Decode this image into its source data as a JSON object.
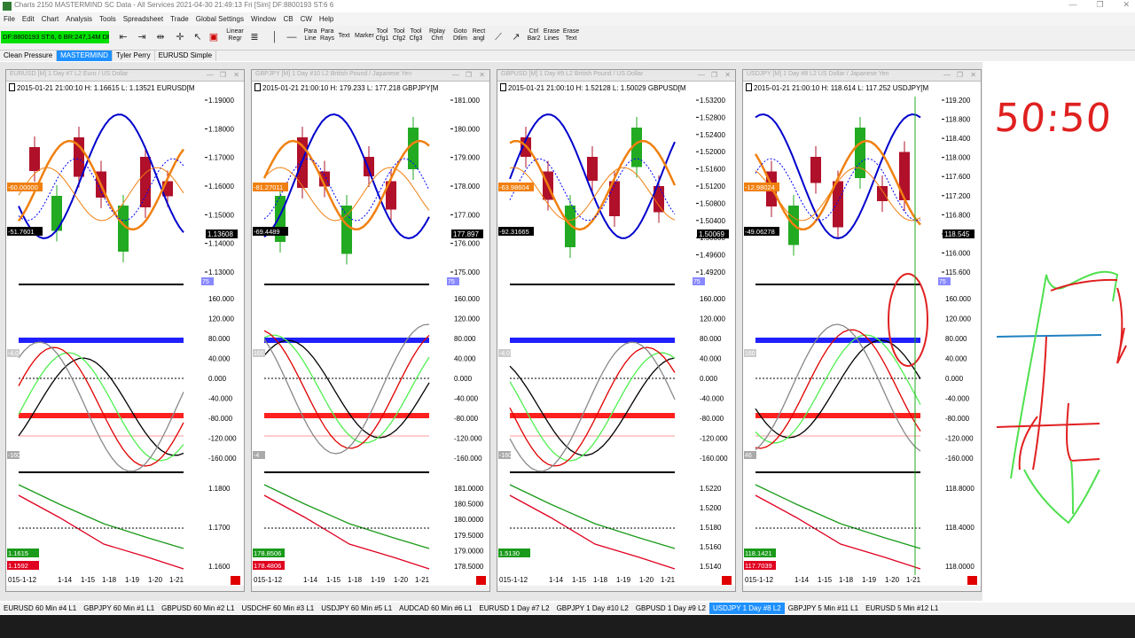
{
  "window": {
    "title": "Charts 2150 MASTERMIND  SC Data - All Services  2021-04-30  21:49:13 Fri [Sim]  DF:8800193  ST:6  6",
    "controls": [
      "—",
      "❐",
      "✕"
    ]
  },
  "menu": [
    "File",
    "Edit",
    "Chart",
    "Analysis",
    "Tools",
    "Spreadsheet",
    "Trade",
    "Global Settings",
    "Window",
    "CB",
    "CW",
    "Help"
  ],
  "toolbar": {
    "account_status": "DF:8800193  ST:6, 6  BR:247,14M  DF",
    "buttons": [
      {
        "l1": "Linear",
        "l2": "Regr"
      },
      {
        "l1": "Para",
        "l2": "Line"
      },
      {
        "l1": "Para",
        "l2": "Rays"
      },
      {
        "l1": "Text",
        "l2": ""
      },
      {
        "l1": "Marker",
        "l2": ""
      },
      {
        "l1": "Tool",
        "l2": "Cfg1"
      },
      {
        "l1": "Tool",
        "l2": "Cfg2"
      },
      {
        "l1": "Tool",
        "l2": "Cfg3"
      },
      {
        "l1": "Rplay",
        "l2": "Chrt"
      },
      {
        "l1": "Goto",
        "l2": "Dtlim"
      },
      {
        "l1": "Rect",
        "l2": "angl"
      },
      {
        "l1": "Ctrl",
        "l2": "Bar2"
      },
      {
        "l1": "Erase",
        "l2": "Lines"
      },
      {
        "l1": "Erase",
        "l2": "Text"
      }
    ]
  },
  "chartbooks": [
    {
      "label": "Clean Pressure",
      "active": false
    },
    {
      "label": "MASTERMIND",
      "active": true
    },
    {
      "label": "Tyler Perry",
      "active": false
    },
    {
      "label": "EURUSD Simple",
      "active": false
    }
  ],
  "panels": [
    {
      "header": "EURUSD [M]  1 Day  #7  L2  Euro / US Dollar",
      "info": "2015-01-21 21:00:10 H: 1.16615 L: 1.13521 EURUSD[M",
      "price_ticks": [
        "1.19000",
        "1.18000",
        "1.17000",
        "1.16000",
        "1.15000",
        "1.14000",
        "1.13000"
      ],
      "current_price": "1.13608",
      "left_tags": [
        "-60.00000",
        "-51.7601"
      ],
      "osc_ticks": [
        "160.000",
        "120.000",
        "80.000",
        "40.000",
        "0.000",
        "-40.000",
        "-80.000",
        "-120.000",
        "-160.000"
      ],
      "osc_tags": [
        "75",
        "-160",
        "-4.0"
      ],
      "lower_ticks": [
        "1.1800",
        "1.1700",
        "1.1600"
      ],
      "lower_tags": [
        "1.1615",
        "1.1592"
      ],
      "dates": [
        "015-1-12",
        "1-14",
        "1-15",
        "1-18",
        "1-19",
        "1-20",
        "1-21"
      ]
    },
    {
      "header": "GBPJPY [M]  1 Day  #10  L2  British Pound / Japanese Yen",
      "info": "2015-01-21 21:00:10 H: 179.233 L: 177.218 GBPJPY[M",
      "price_ticks": [
        "181.000",
        "180.000",
        "179.000",
        "178.000",
        "177.000",
        "176.000",
        "175.000"
      ],
      "current_price": "177.897",
      "left_tags": [
        "-81.27011",
        "-69.4489"
      ],
      "osc_ticks": [
        "160.000",
        "120.000",
        "80.000",
        "40.000",
        "0.000",
        "-40.000",
        "-80.000",
        "-120.000",
        "-160.000"
      ],
      "osc_tags": [
        "75",
        "-4",
        "160"
      ],
      "lower_ticks": [
        "181.0000",
        "180.5000",
        "180.0000",
        "179.5000",
        "179.0000",
        "178.5000"
      ],
      "lower_tags": [
        "178.8506",
        "178.4806"
      ],
      "dates": [
        "015-1-12",
        "1-14",
        "1-15",
        "1-18",
        "1-19",
        "1-20",
        "1-21"
      ]
    },
    {
      "header": "GBPUSD [M]  1 Day  #9  L2  British Pound / US Dollar",
      "info": "2015-01-21 21:00:10 H: 1.52128 L: 1.50029 GBPUSD[M",
      "price_ticks": [
        "1.53200",
        "1.52800",
        "1.52400",
        "1.52000",
        "1.51600",
        "1.51200",
        "1.50800",
        "1.50400",
        "1.50000",
        "1.49600",
        "1.49200"
      ],
      "current_price": "1.50069",
      "left_tags": [
        "-63.98604",
        "-92.31665"
      ],
      "osc_ticks": [
        "160.000",
        "120.000",
        "80.000",
        "40.000",
        "0.000",
        "-40.000",
        "-80.000",
        "-120.000",
        "-160.000"
      ],
      "osc_tags": [
        "75",
        "-160",
        "-4.0"
      ],
      "lower_ticks": [
        "1.5220",
        "1.5200",
        "1.5180",
        "1.5160",
        "1.5140"
      ],
      "lower_tags": [
        "1.5130"
      ],
      "dates": [
        "015-1-12",
        "1-14",
        "1-15",
        "1-18",
        "1-19",
        "1-20",
        "1-21"
      ]
    },
    {
      "header": "USDJPY [M]  1 Day  #8  L2  US Dollar / Japanese Yen",
      "info": "2015-01-21 21:00:10 H: 118.614 L: 117.252 USDJPY[M",
      "price_ticks": [
        "119.200",
        "118.800",
        "118.400",
        "118.000",
        "117.600",
        "117.200",
        "116.800",
        "116.400",
        "116.000",
        "115.600"
      ],
      "current_price": "118.545",
      "left_tags": [
        "-12.98024",
        "-49.06278"
      ],
      "osc_ticks": [
        "160.000",
        "120.000",
        "80.000",
        "40.000",
        "0.000",
        "-40.000",
        "-80.000",
        "-120.000",
        "-160.000"
      ],
      "osc_tags": [
        "75",
        "46",
        "160"
      ],
      "lower_ticks": [
        "118.8000",
        "118.4000",
        "118.0000"
      ],
      "lower_tags": [
        "118.1421",
        "117.7039"
      ],
      "dates": [
        "015-1-12",
        "1-14",
        "1-15",
        "1-18",
        "1-19",
        "1-20",
        "1-21"
      ]
    }
  ],
  "bottom_tabs": [
    {
      "label": "EURUSD  60 Min  #4  L1",
      "active": false
    },
    {
      "label": "GBPJPY  60 Min  #1  L1",
      "active": false
    },
    {
      "label": "GBPUSD  60 Min  #2  L1",
      "active": false
    },
    {
      "label": "USDCHF  60 Min  #3  L1",
      "active": false
    },
    {
      "label": "USDJPY  60 Min  #5  L1",
      "active": false
    },
    {
      "label": "AUDCAD  60 Min  #6  L1",
      "active": false
    },
    {
      "label": "EURUSD  1 Day  #7  L2",
      "active": false
    },
    {
      "label": "GBPJPY  1 Day  #10  L2",
      "active": false
    },
    {
      "label": "GBPUSD  1 Day  #9  L2",
      "active": false
    },
    {
      "label": "USDJPY  1 Day  #8  L2",
      "active": true
    },
    {
      "label": "GBPJPY  5 Min  #11  L1",
      "active": false
    },
    {
      "label": "EURUSD  5 Min  #12  L1",
      "active": false
    }
  ],
  "annotation": {
    "ratio_text": "50:50"
  },
  "colors": {
    "accent_blue": "#1e90ff",
    "account_green": "#00e000",
    "candle_up": "#22aa22",
    "candle_down": "#b0102a",
    "line_blue": "#0000cc",
    "line_orange": "#f08010",
    "band_red": "#ff2020",
    "band_blue": "#2020ff",
    "annotation_red": "#e02020",
    "annotation_green": "#50e050"
  }
}
